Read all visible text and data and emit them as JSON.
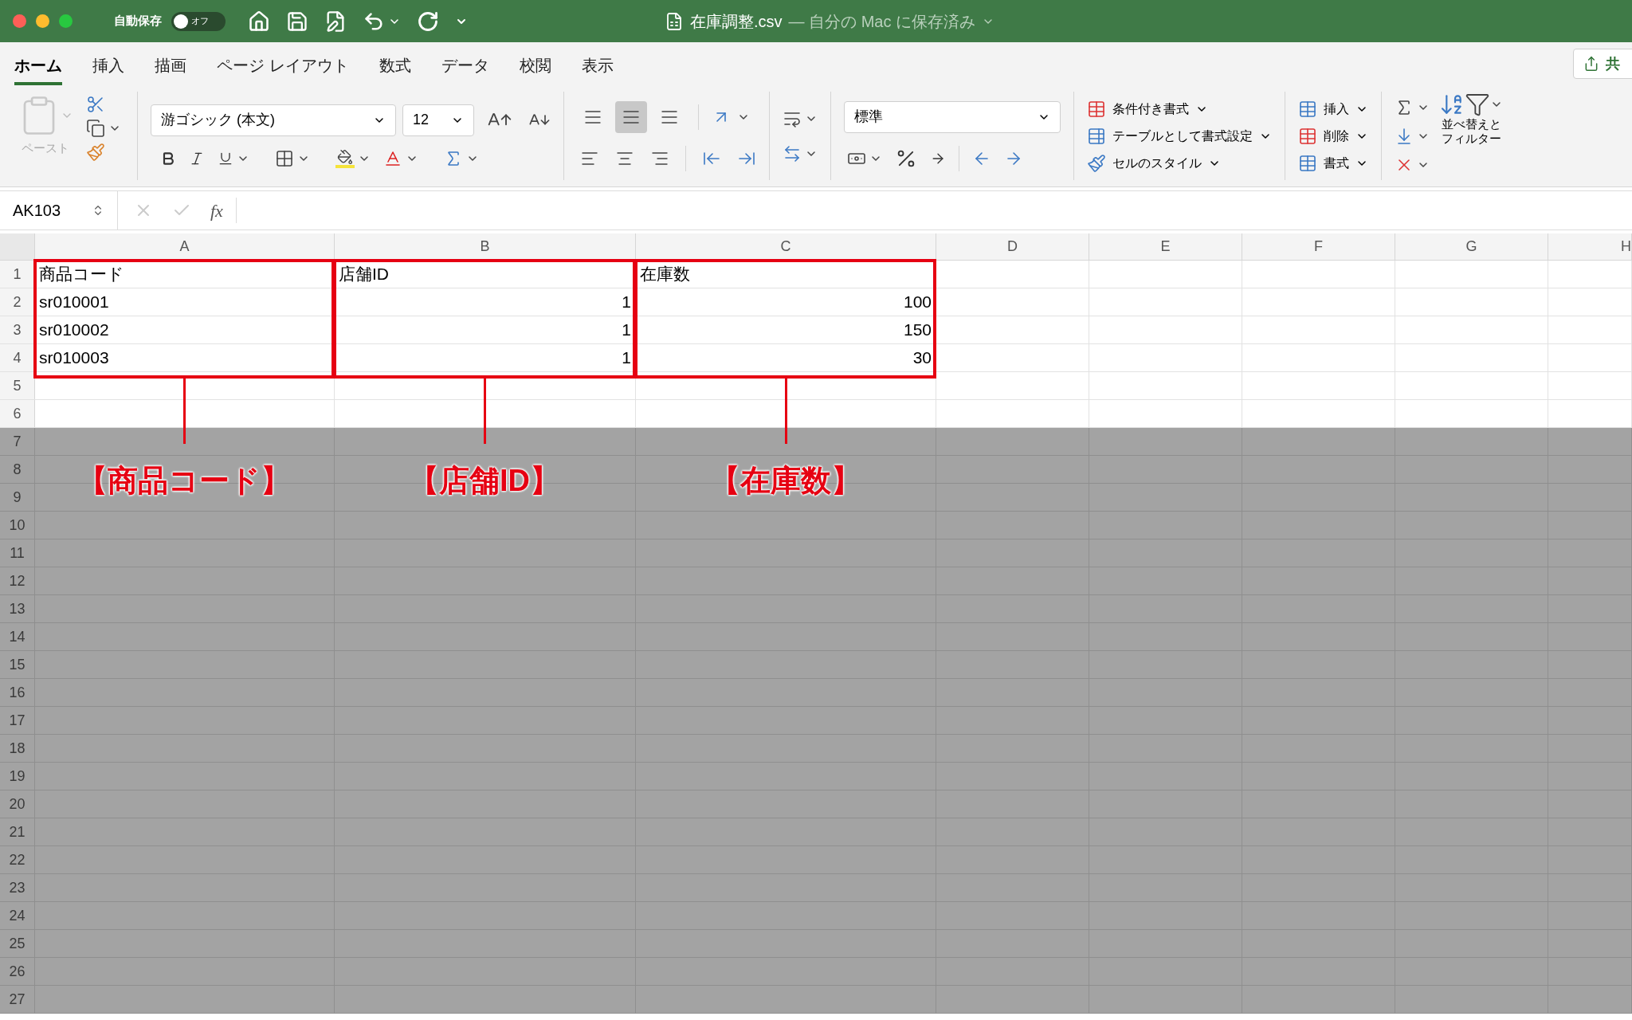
{
  "title_bar": {
    "autosave_label": "自動保存",
    "autosave_toggle": {
      "label": "オフ",
      "on": false
    },
    "document_title": "在庫調整.csv",
    "save_status": "— 自分の Mac に保存済み"
  },
  "ribbon_tabs": [
    {
      "label": "ホーム",
      "selected": true
    },
    {
      "label": "挿入",
      "selected": false
    },
    {
      "label": "描画",
      "selected": false
    },
    {
      "label": "ページ レイアウト",
      "selected": false
    },
    {
      "label": "数式",
      "selected": false
    },
    {
      "label": "データ",
      "selected": false
    },
    {
      "label": "校閲",
      "selected": false
    },
    {
      "label": "表示",
      "selected": false
    }
  ],
  "share_button": {
    "label": "共"
  },
  "ribbon": {
    "paste_label": "ペースト",
    "font_name": "游ゴシック (本文)",
    "font_size": "12",
    "vertical_align": [
      {
        "selected": false
      },
      {
        "selected": true
      },
      {
        "selected": false
      }
    ],
    "number_format": "標準",
    "styles": [
      "条件付き書式",
      "テーブルとして書式設定",
      "セルのスタイル"
    ],
    "cells": [
      "挿入",
      "削除",
      "書式"
    ],
    "sort_filter": [
      "並べ替えと",
      "フィルター"
    ]
  },
  "formula_bar": {
    "name_box": "AK103",
    "function_label": "fx"
  },
  "sheet": {
    "columns": [
      "A",
      "B",
      "C",
      "D",
      "E",
      "F",
      "G",
      "H"
    ],
    "rows": [
      {
        "number": "1",
        "dimmed": false,
        "cells": [
          {
            "kind": "text",
            "text": "商品コード"
          },
          {
            "kind": "text",
            "text": "店舗ID"
          },
          {
            "kind": "text",
            "text": "在庫数"
          }
        ]
      },
      {
        "number": "2",
        "dimmed": false,
        "cells": [
          {
            "kind": "text",
            "text": "sr010001"
          },
          {
            "kind": "number",
            "text": "1"
          },
          {
            "kind": "number",
            "text": "100"
          }
        ]
      },
      {
        "number": "3",
        "dimmed": false,
        "cells": [
          {
            "kind": "text",
            "text": "sr010002"
          },
          {
            "kind": "number",
            "text": "1"
          },
          {
            "kind": "number",
            "text": "150"
          }
        ]
      },
      {
        "number": "4",
        "dimmed": false,
        "cells": [
          {
            "kind": "text",
            "text": "sr010003"
          },
          {
            "kind": "number",
            "text": "1"
          },
          {
            "kind": "number",
            "text": "30"
          }
        ]
      },
      {
        "number": "5",
        "dimmed": false
      },
      {
        "number": "6",
        "dimmed": false
      },
      {
        "number": "7",
        "dimmed": true
      },
      {
        "number": "8",
        "dimmed": true
      },
      {
        "number": "9",
        "dimmed": true
      },
      {
        "number": "10",
        "dimmed": true
      },
      {
        "number": "11",
        "dimmed": true
      },
      {
        "number": "12",
        "dimmed": true
      },
      {
        "number": "13",
        "dimmed": true
      },
      {
        "number": "14",
        "dimmed": true
      },
      {
        "number": "15",
        "dimmed": true
      },
      {
        "number": "16",
        "dimmed": true
      },
      {
        "number": "17",
        "dimmed": true
      },
      {
        "number": "18",
        "dimmed": true
      },
      {
        "number": "19",
        "dimmed": true
      },
      {
        "number": "20",
        "dimmed": true
      },
      {
        "number": "21",
        "dimmed": true
      },
      {
        "number": "22",
        "dimmed": true
      },
      {
        "number": "23",
        "dimmed": true
      },
      {
        "number": "24",
        "dimmed": true
      },
      {
        "number": "25",
        "dimmed": true
      },
      {
        "number": "26",
        "dimmed": true
      },
      {
        "number": "27",
        "dimmed": true
      }
    ]
  },
  "annotations": [
    {
      "label": "【商品コード】"
    },
    {
      "label": "【店舗ID】"
    },
    {
      "label": "【在庫数】"
    }
  ]
}
